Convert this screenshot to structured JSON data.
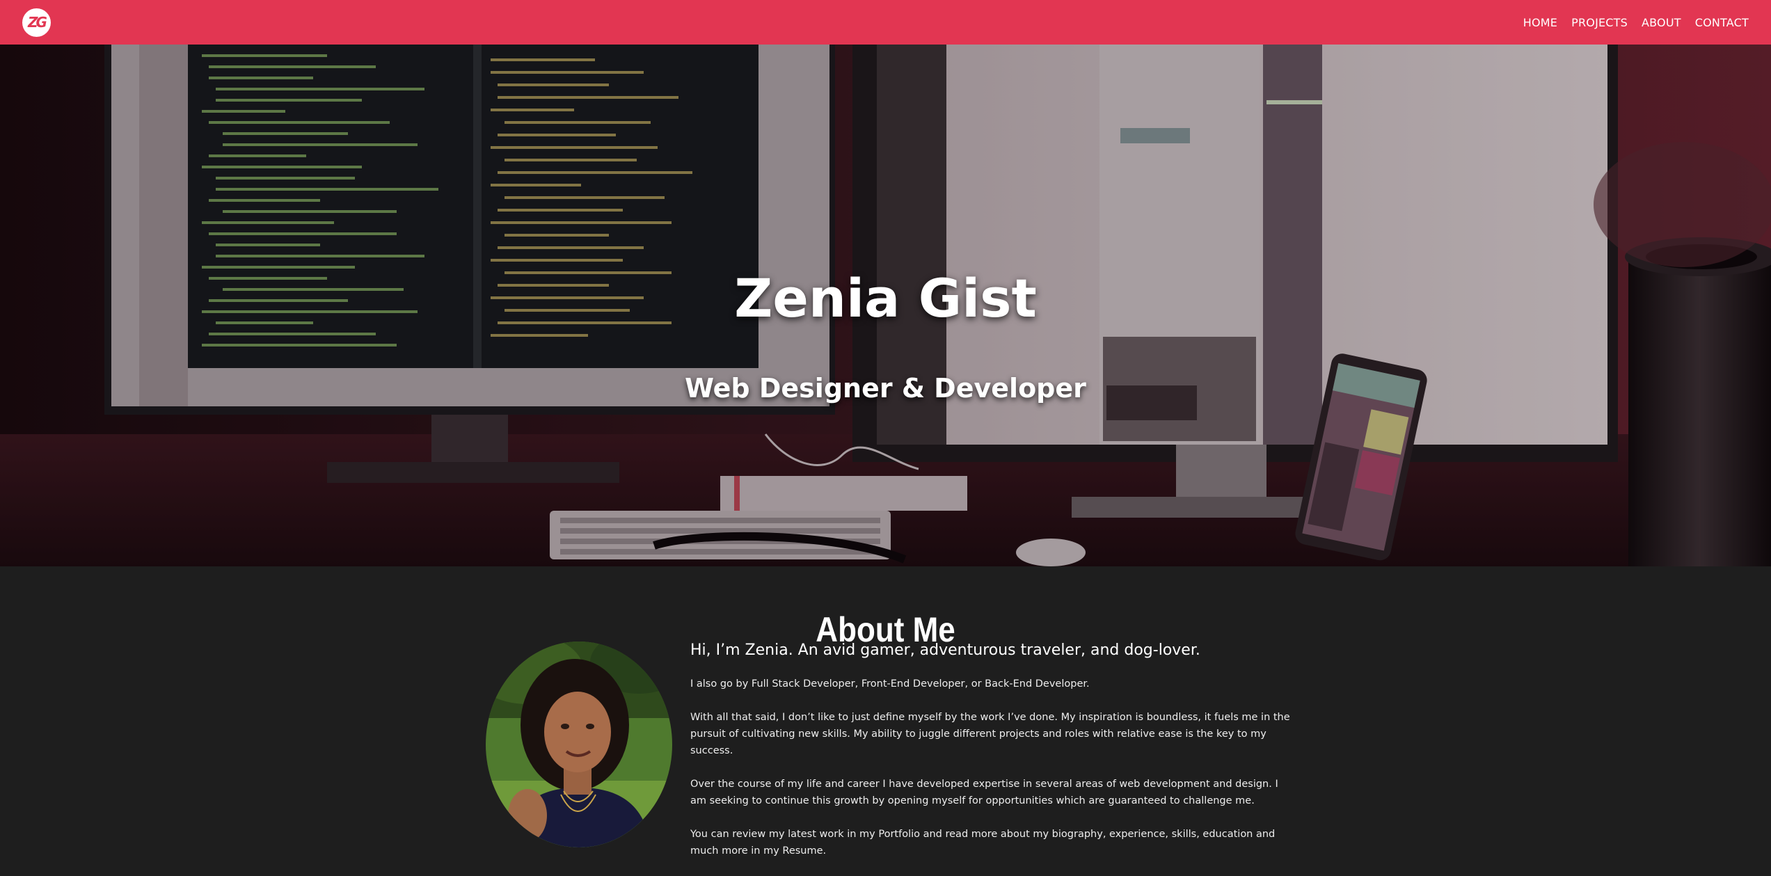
{
  "logo": {
    "text": "ZG",
    "color": "#e23652"
  },
  "nav": {
    "items": [
      {
        "label": "HOME"
      },
      {
        "label": "PROJECTS"
      },
      {
        "label": "ABOUT"
      },
      {
        "label": "CONTACT"
      }
    ],
    "background": "#e23652"
  },
  "hero": {
    "title": "Zenia Gist",
    "subtitle": "Web Designer & Developer",
    "background_description_icon": "desk-monitors-photo"
  },
  "about": {
    "title": "About Me",
    "lead": "Hi, I’m Zenia. An avid gamer, adventurous traveler, and dog-lover.",
    "paragraphs": [
      "I also go by Full Stack Developer, Front-End Developer, or Back-End Developer.",
      "With all that said, I don’t like to just define myself by the work I’ve done. My inspiration is boundless, it fuels me in the pursuit of cultivating new skills. My ability to juggle different projects and roles with relative ease is the key to my success.",
      "Over the course of my life and career I have developed expertise in several areas of web development and design. I am seeking to continue this growth by opening myself for opportunities which are guaranteed to challenge me.",
      "You can review my latest work in my Portfolio and read more about my biography, experience, skills, education and much more in my Resume."
    ]
  }
}
